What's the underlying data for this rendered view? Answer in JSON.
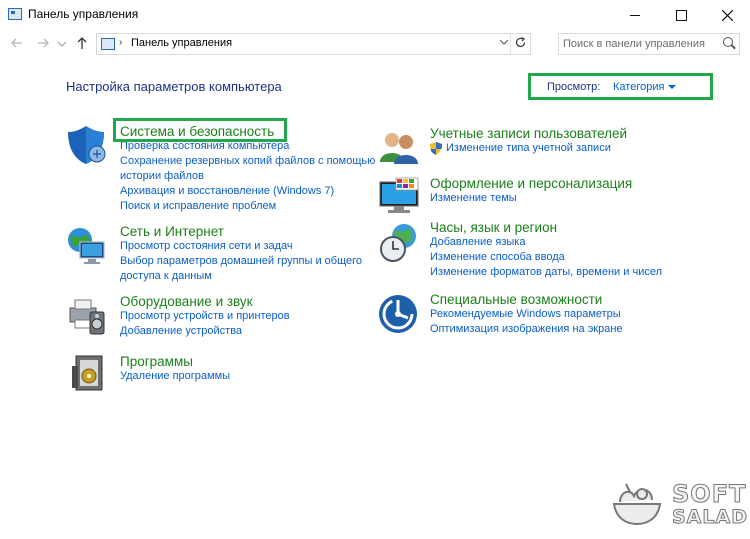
{
  "window": {
    "title": "Панель управления"
  },
  "address": {
    "path": "Панель управления",
    "search_placeholder": "Поиск в панели управления"
  },
  "header": {
    "title": "Настройка параметров компьютера",
    "view_label": "Просмотр:",
    "view_value": "Категория"
  },
  "categories": [
    {
      "title": "Система и безопасность",
      "icon": "shield-icon",
      "links": [
        "Проверка состояния компьютера",
        "Сохранение резервных копий файлов с помощью истории файлов",
        "Архивация и восстановление (Windows 7)",
        "Поиск и исправление проблем"
      ]
    },
    {
      "title": "Сеть и Интернет",
      "icon": "network-globe-icon",
      "links": [
        "Просмотр состояния сети и задач",
        "Выбор параметров домашней группы и общего доступа к данным"
      ]
    },
    {
      "title": "Оборудование и звук",
      "icon": "printer-speaker-icon",
      "links": [
        "Просмотр устройств и принтеров",
        "Добавление устройства"
      ]
    },
    {
      "title": "Программы",
      "icon": "programs-box-icon",
      "links": [
        "Удаление программы"
      ]
    },
    {
      "title": "Учетные записи пользователей",
      "icon": "users-icon",
      "links": [
        "Изменение типа учетной записи"
      ]
    },
    {
      "title": "Оформление и персонализация",
      "icon": "monitor-palette-icon",
      "links": [
        "Изменение темы"
      ]
    },
    {
      "title": "Часы, язык и регион",
      "icon": "clock-globe-icon",
      "links": [
        "Добавление языка",
        "Изменение способа ввода",
        "Изменение форматов даты, времени и чисел"
      ]
    },
    {
      "title": "Специальные возможности",
      "icon": "accessibility-icon",
      "links": [
        "Рекомендуемые Windows параметры",
        "Оптимизация изображения на экране"
      ]
    }
  ],
  "watermark": {
    "line1": "SOFT",
    "line2": "SALAD"
  },
  "colors": {
    "highlight": "#22a84a",
    "category_title": "#1a7f1a",
    "link": "#0a5fc7",
    "heading": "#1e3287"
  }
}
